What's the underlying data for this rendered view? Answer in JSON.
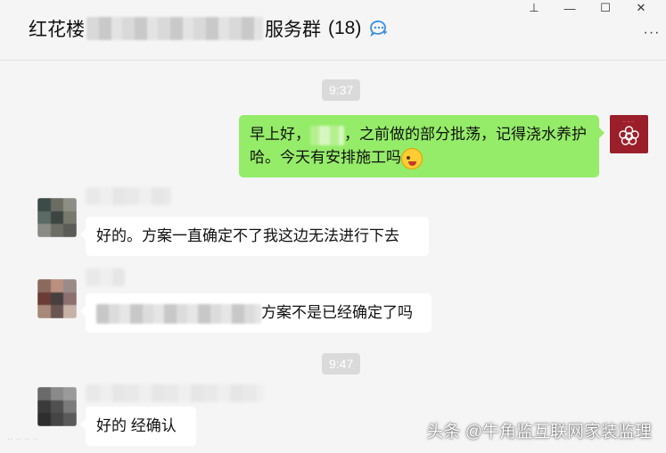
{
  "header": {
    "title_prefix": "红花楼",
    "title_suffix": "服务群",
    "member_count": "(18)",
    "more_label": "···"
  },
  "window_controls": {
    "pin": "⊥",
    "minimize": "—",
    "maximize": "☐",
    "close": "✕"
  },
  "timestamps": [
    "9:37",
    "9:47"
  ],
  "messages": {
    "m1": {
      "sender": "self",
      "part1": "早上好，",
      "part2": "，之前做的部分批荡，记得浇水养护哈。今天有安排施工吗"
    },
    "m2": {
      "sender": "other",
      "text": "好的。方案一直确定不了我这边无法进行下去"
    },
    "m3": {
      "sender": "other",
      "text": "方案不是已经确定了吗"
    },
    "m4": {
      "sender": "other",
      "text": "好的 经确认"
    }
  },
  "watermark": "头条 @牛角监互联网家装监理",
  "colors": {
    "background": "#f5f5f5",
    "self_bubble": "#95ec69",
    "other_bubble": "#ffffff",
    "timestamp_pill": "#dadada",
    "self_avatar": "#9a1f2b",
    "group_icon": "#3b8fe0"
  },
  "icons": {
    "group_icon": "group-chat-icon",
    "pin": "pin-icon",
    "minimize": "minimize-icon",
    "maximize": "maximize-icon",
    "close": "close-icon",
    "more": "more-icon",
    "emoji": "wink-emoji-icon"
  }
}
